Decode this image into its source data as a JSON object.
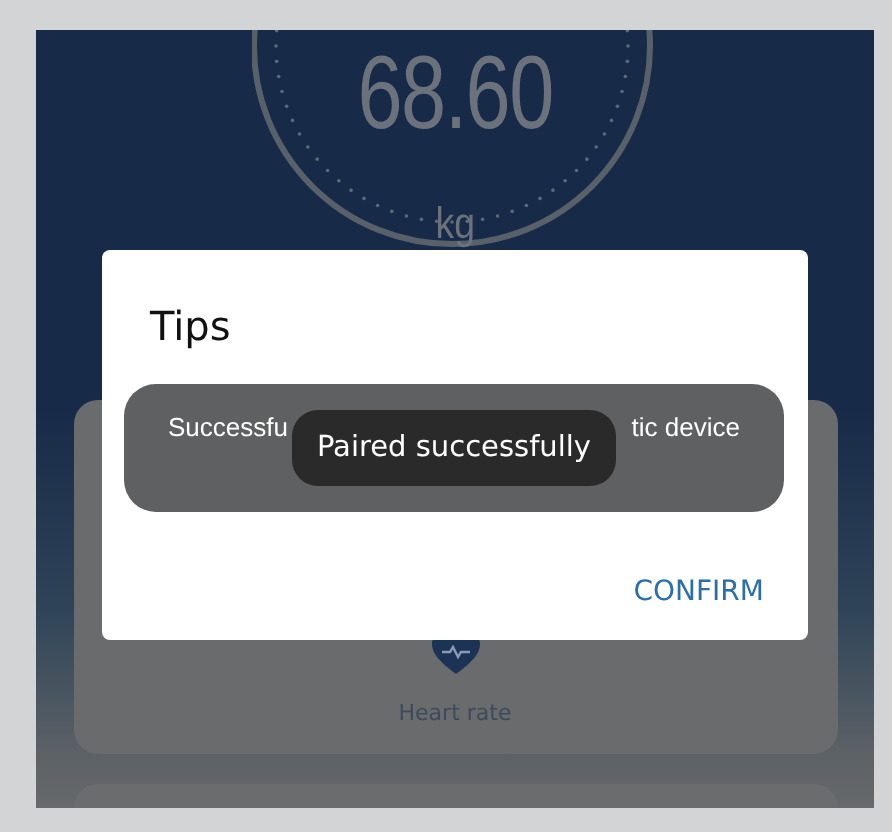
{
  "gauge": {
    "value": "68.60",
    "unit": "kg"
  },
  "metric_card": {
    "label": "Heart rate"
  },
  "dialog": {
    "title": "Tips",
    "buttons": [
      "CONFIRM"
    ]
  },
  "toasts": [
    {
      "kind": "wide",
      "visible_parts": [
        "Successfu",
        "tic device"
      ]
    },
    {
      "kind": "pill",
      "text": "Paired successfully"
    }
  ]
}
